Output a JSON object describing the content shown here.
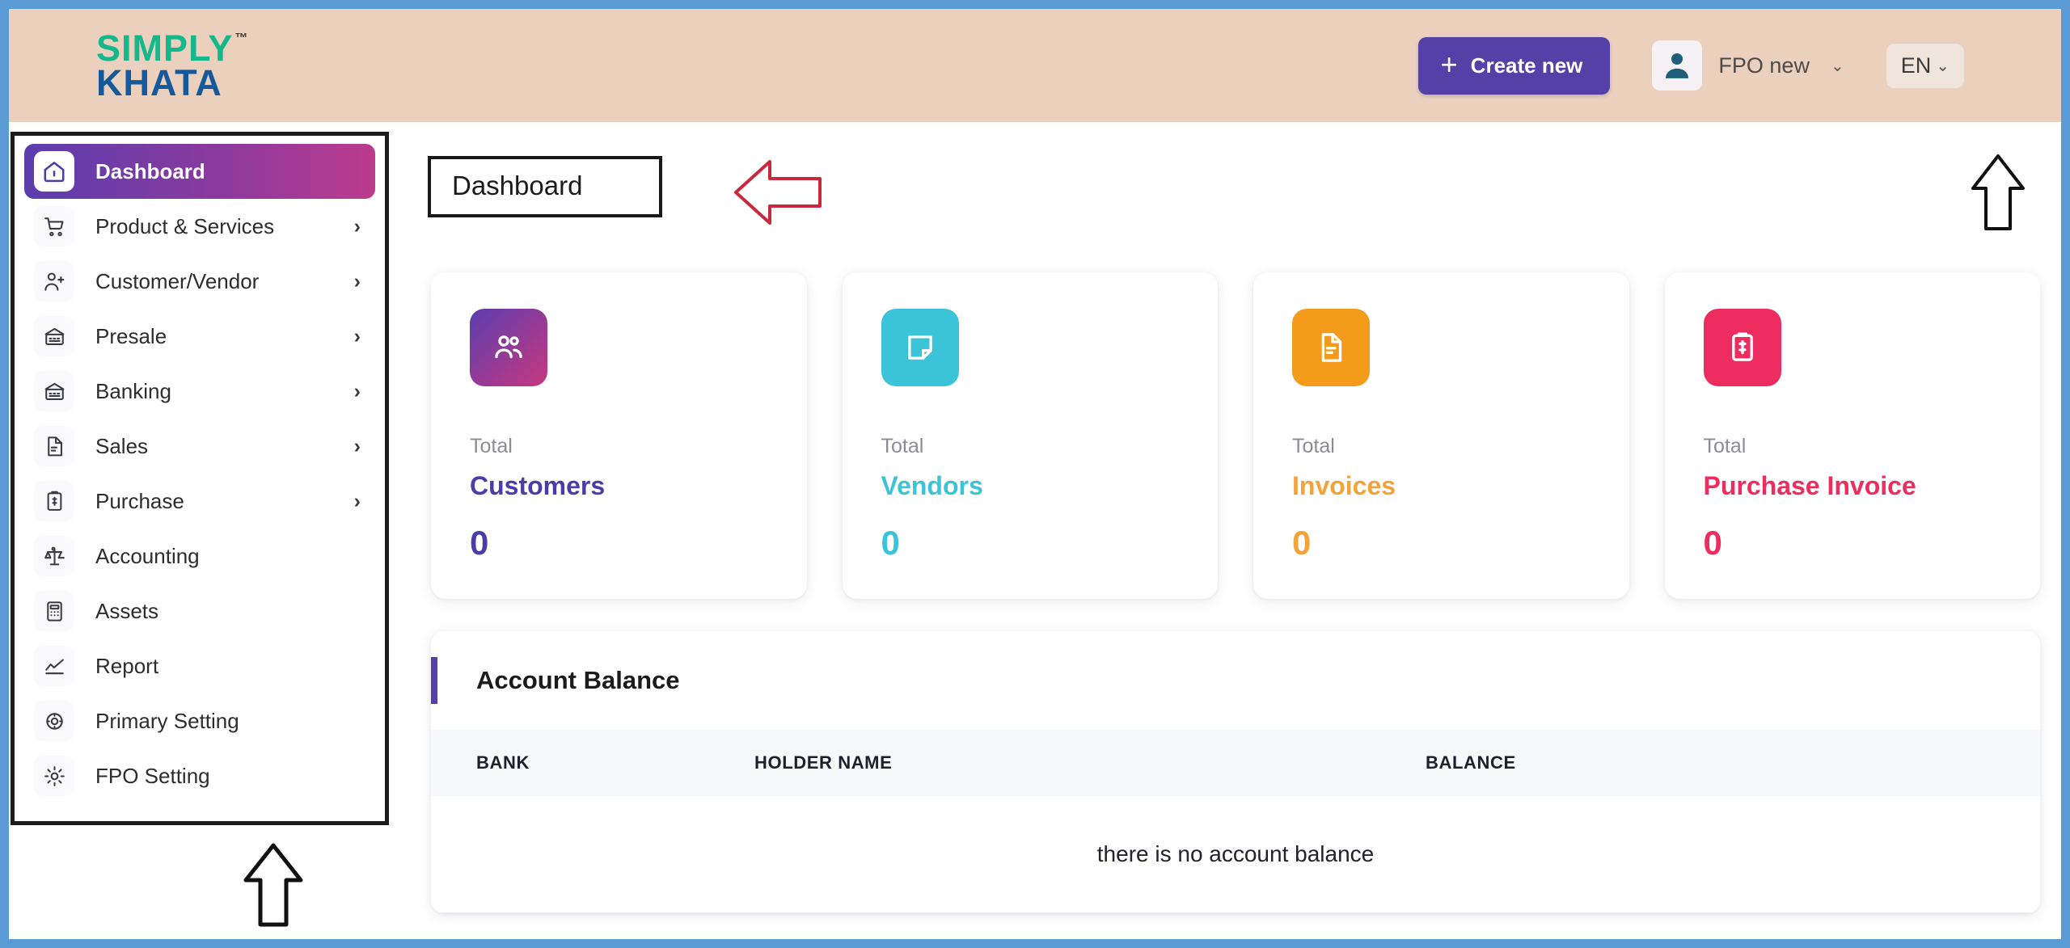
{
  "window": {
    "outer_border_color": "#5B9BD5"
  },
  "header": {
    "logo_line1": "SIMPLY",
    "logo_line2": "KHATA",
    "logo_tm": "™",
    "logo_color_1": "#15B88A",
    "logo_color_2": "#14599B",
    "background_color": "#EBD0BE",
    "create_new_label": "Create new",
    "create_new_plus": "+",
    "create_new_color": "#5341A8",
    "user_name": "FPO new",
    "user_chevron": "⌄",
    "language": "EN",
    "language_chevron": "⌄"
  },
  "sidebar": {
    "items": [
      {
        "label": "Dashboard",
        "icon": "home-icon",
        "has_chevron": false,
        "active": true
      },
      {
        "label": "Product & Services",
        "icon": "cart-icon",
        "has_chevron": true,
        "active": false
      },
      {
        "label": "Customer/Vendor",
        "icon": "user-plus-icon",
        "has_chevron": true,
        "active": false
      },
      {
        "label": "Presale",
        "icon": "bank-icon",
        "has_chevron": true,
        "active": false
      },
      {
        "label": "Banking",
        "icon": "bank-icon",
        "has_chevron": true,
        "active": false
      },
      {
        "label": "Sales",
        "icon": "document-icon",
        "has_chevron": true,
        "active": false
      },
      {
        "label": "Purchase",
        "icon": "clipboard-icon",
        "has_chevron": true,
        "active": false
      },
      {
        "label": "Accounting",
        "icon": "scales-icon",
        "has_chevron": false,
        "active": false
      },
      {
        "label": "Assets",
        "icon": "calculator-icon",
        "has_chevron": false,
        "active": false
      },
      {
        "label": "Report",
        "icon": "chart-line-icon",
        "has_chevron": false,
        "active": false
      },
      {
        "label": "Primary Setting",
        "icon": "settings-icon",
        "has_chevron": false,
        "active": false
      },
      {
        "label": "FPO Setting",
        "icon": "gear-icon",
        "has_chevron": false,
        "active": false
      }
    ],
    "chevron_glyph": "›",
    "active_gradient_from": "#5B3DAE",
    "active_gradient_to": "#BC3B8C"
  },
  "main": {
    "page_title": "Dashboard",
    "stat_cards": [
      {
        "total_label": "Total",
        "name": "Customers",
        "value": "0",
        "icon": "users-icon",
        "color": "#8A3A9E",
        "gradient_from": "#5B3DAE",
        "gradient_to": "#C8387F",
        "text_color": "#4B3DA8"
      },
      {
        "total_label": "Total",
        "name": "Vendors",
        "value": "0",
        "icon": "note-icon",
        "color": "#3BC3D8",
        "gradient_from": "#3BC3D8",
        "gradient_to": "#3BC3D8",
        "text_color": "#3BC3D8"
      },
      {
        "total_label": "Total",
        "name": "Invoices",
        "value": "0",
        "icon": "file-icon",
        "color": "#F59B1C",
        "gradient_from": "#F59B1C",
        "gradient_to": "#F59B1C",
        "text_color": "#F2A33A"
      },
      {
        "total_label": "Total",
        "name": "Purchase Invoice",
        "value": "0",
        "icon": "receipt-icon",
        "color": "#ED2D5F",
        "gradient_from": "#ED2D5F",
        "gradient_to": "#ED2D5F",
        "text_color": "#ED2D5F"
      }
    ],
    "balance_panel": {
      "title": "Account Balance",
      "accent_color": "#5341A8",
      "columns": [
        "BANK",
        "HOLDER NAME",
        "BALANCE"
      ],
      "rows": [],
      "empty_message": "there is no account balance"
    }
  },
  "annotations": {
    "arrow_left_color": "#C9283E",
    "arrow_up_color": "#111111",
    "title_box_border": "#191919"
  }
}
